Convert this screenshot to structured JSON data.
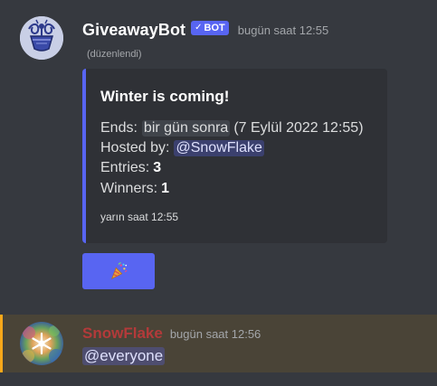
{
  "message1": {
    "author": "GiveawayBot",
    "bot_tag": {
      "check": "✓",
      "label": "BOT"
    },
    "timestamp": "bugün saat 12:55",
    "edited": "(düzenlendi)",
    "avatar_icon": "giveaway-bot-avatar",
    "embed": {
      "accent_color": "#5865f2",
      "title": "Winter is coming!",
      "ends_label": "Ends:",
      "ends_relative": "bir gün sonra",
      "ends_absolute": "(7 Eylül 2022 12:55)",
      "hosted_label": "Hosted by:",
      "host_mention": "@SnowFlake",
      "entries_label": "Entries:",
      "entries_value": "3",
      "winners_label": "Winners:",
      "winners_value": "1",
      "footer": "yarın saat 12:55"
    },
    "button": {
      "icon": "party-popper-icon",
      "color": "#5865f2"
    }
  },
  "message2": {
    "author": "SnowFlake",
    "author_color": "#b33a3a",
    "timestamp": "bugün saat 12:56",
    "content": "@everyone",
    "highlight_color": "#faa81a",
    "avatar_icon": "snowflake-avatar"
  }
}
